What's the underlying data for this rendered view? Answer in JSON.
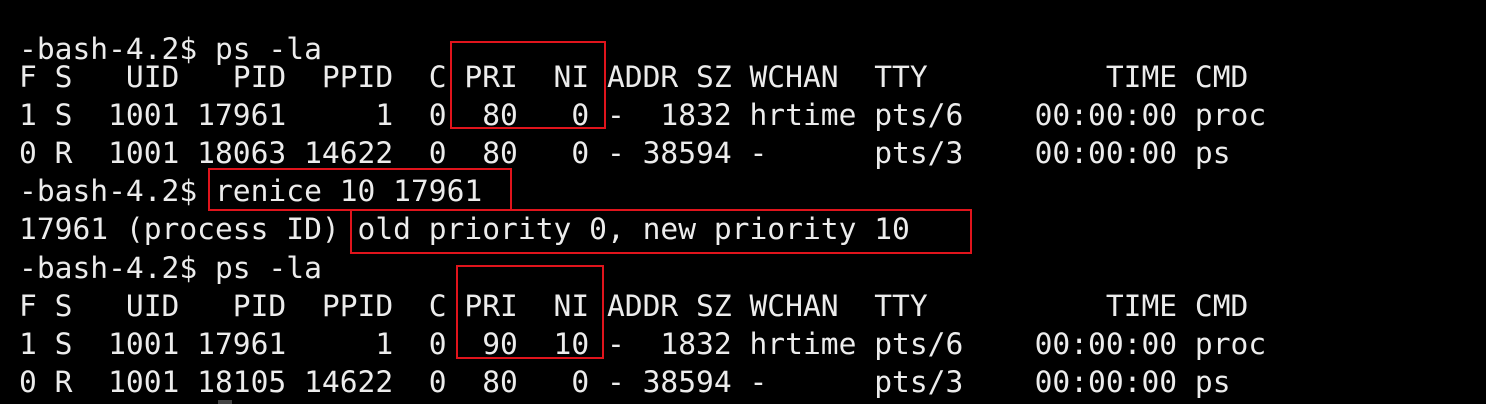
{
  "terminal": {
    "lines": [
      "-bash-4.2$ ps -la",
      "F S   UID   PID  PPID  C PRI  NI ADDR SZ WCHAN  TTY          TIME CMD",
      "1 S  1001 17961     1  0  80   0 -  1832 hrtime pts/6    00:00:00 proc",
      "0 R  1001 18063 14622  0  80   0 - 38594 -      pts/3    00:00:00 ps",
      "-bash-4.2$ renice 10 17961",
      "17961 (process ID) old priority 0, new priority 10",
      "-bash-4.2$ ps -la",
      "F S   UID   PID  PPID  C PRI  NI ADDR SZ WCHAN  TTY          TIME CMD",
      "1 S  1001 17961     1  0  90  10 -  1832 hrtime pts/6    00:00:00 proc",
      "0 R  1001 18105 14622  0  80   0 - 38594 -      pts/3    00:00:00 ps"
    ],
    "highlight_color": "#e0141c",
    "text_color": "#ececec",
    "background_color": "#000000"
  }
}
